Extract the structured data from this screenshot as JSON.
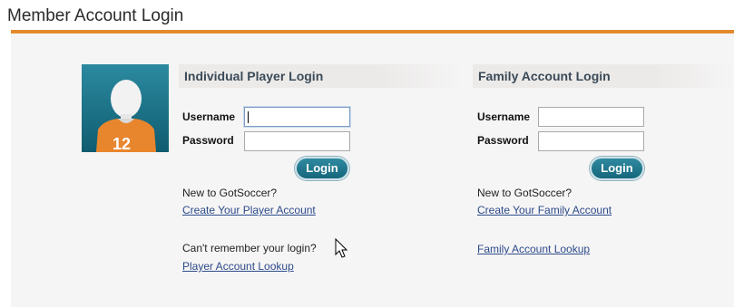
{
  "header": {
    "title": "Member Account Login"
  },
  "individual": {
    "heading": "Individual Player Login",
    "username_label": "Username",
    "password_label": "Password",
    "username_value": "",
    "password_value": "",
    "login_label": "Login",
    "new_text": "New to GotSoccer?",
    "create_link": "Create Your Player Account",
    "forgot_text": "Can't remember your login?",
    "lookup_link": "Player Account Lookup"
  },
  "family": {
    "heading": "Family Account Login",
    "username_label": "Username",
    "password_label": "Password",
    "username_value": "",
    "password_value": "",
    "login_label": "Login",
    "new_text": "New to GotSoccer?",
    "create_link": "Create Your Family Account",
    "lookup_link": "Family Account Lookup"
  },
  "avatar": {
    "jersey_number": "12"
  },
  "colors": {
    "accent_rule": "#e38b2c",
    "button": "#15677c",
    "link": "#2c4b8a",
    "avatar_bg": "#1a6f85",
    "jersey": "#e8862e"
  },
  "icons": {
    "avatar": "player-avatar-icon",
    "cursor": "mouse-pointer-icon"
  }
}
